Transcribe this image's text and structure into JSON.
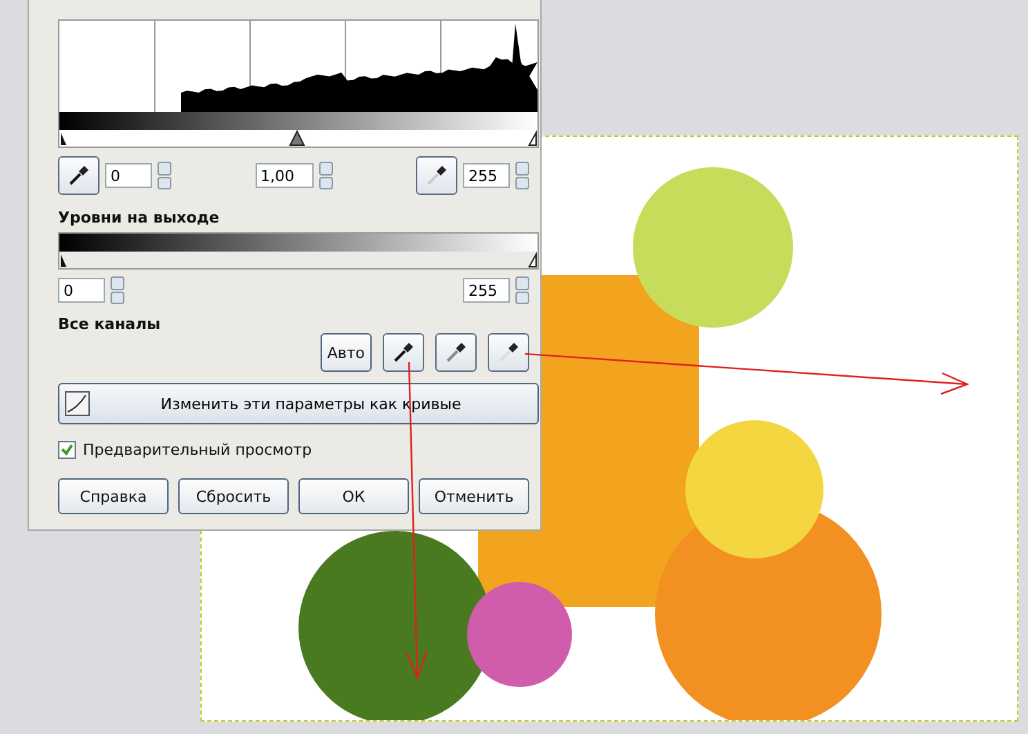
{
  "input_levels": {
    "low": "0",
    "gamma": "1,00",
    "high": "255"
  },
  "output_levels": {
    "title": "Уровни на выходе",
    "low": "0",
    "high": "255"
  },
  "channels": {
    "title": "Все каналы",
    "auto_button": "Авто"
  },
  "curves_button": "Изменить эти параметры как кривые",
  "preview": {
    "label": "Предварительный просмотр",
    "checked": true
  },
  "buttons": [
    "Справка",
    "Сбросить",
    "ОК",
    "Отменить"
  ]
}
